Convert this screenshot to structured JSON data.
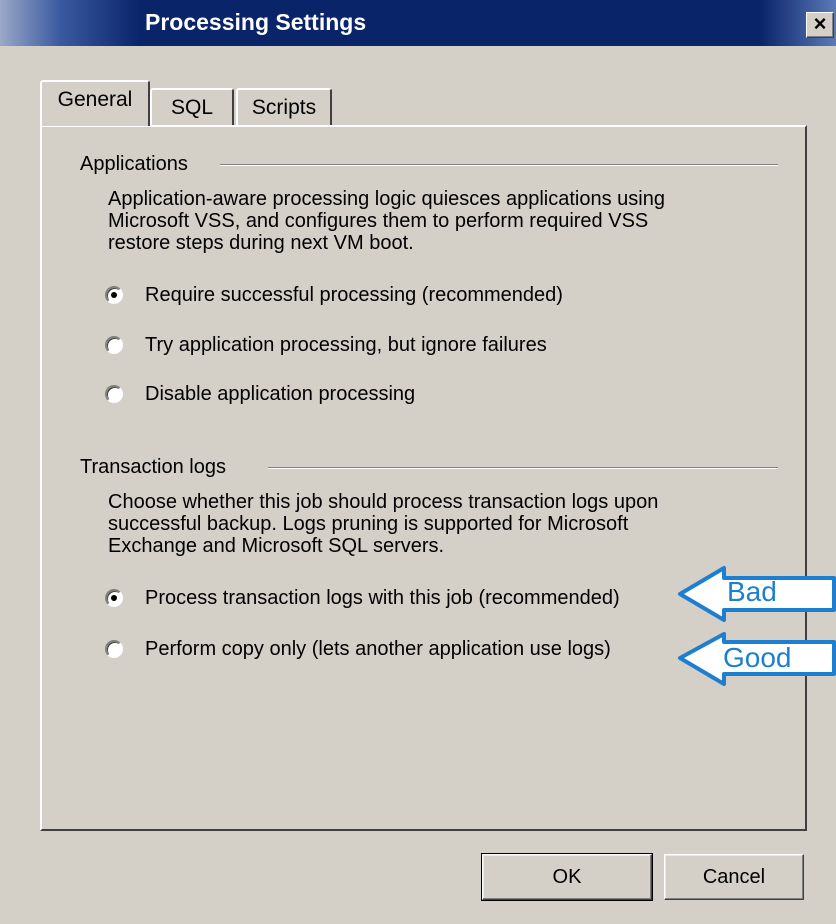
{
  "window": {
    "title": "Processing Settings",
    "close_label": "×"
  },
  "tabs": [
    {
      "label": "General",
      "active": true
    },
    {
      "label": "SQL",
      "active": false
    },
    {
      "label": "Scripts",
      "active": false
    }
  ],
  "applications": {
    "heading": "Applications",
    "description_lines": [
      "Application-aware processing logic quiesces applications using",
      "Microsoft VSS, and configures them to perform required VSS",
      "restore steps during next VM boot."
    ],
    "options": [
      {
        "label": "Require successful processing  (recommended)",
        "checked": true
      },
      {
        "label": "Try application processing, but ignore failures",
        "checked": false
      },
      {
        "label": "Disable application processing",
        "checked": false
      }
    ]
  },
  "transaction_logs": {
    "heading": "Transaction logs",
    "description_lines": [
      "Choose whether this job should process transaction logs upon",
      "successful backup. Logs pruning is supported for Microsoft",
      "Exchange and Microsoft SQL servers."
    ],
    "options": [
      {
        "label": "Process transaction logs with this job (recommended)",
        "checked": true
      },
      {
        "label": "Perform copy only (lets another application use logs)",
        "checked": false
      }
    ]
  },
  "annotations": {
    "bad": "Bad",
    "good": "Good",
    "color": "#1e7fd0"
  },
  "buttons": {
    "ok": "OK",
    "cancel": "Cancel"
  }
}
